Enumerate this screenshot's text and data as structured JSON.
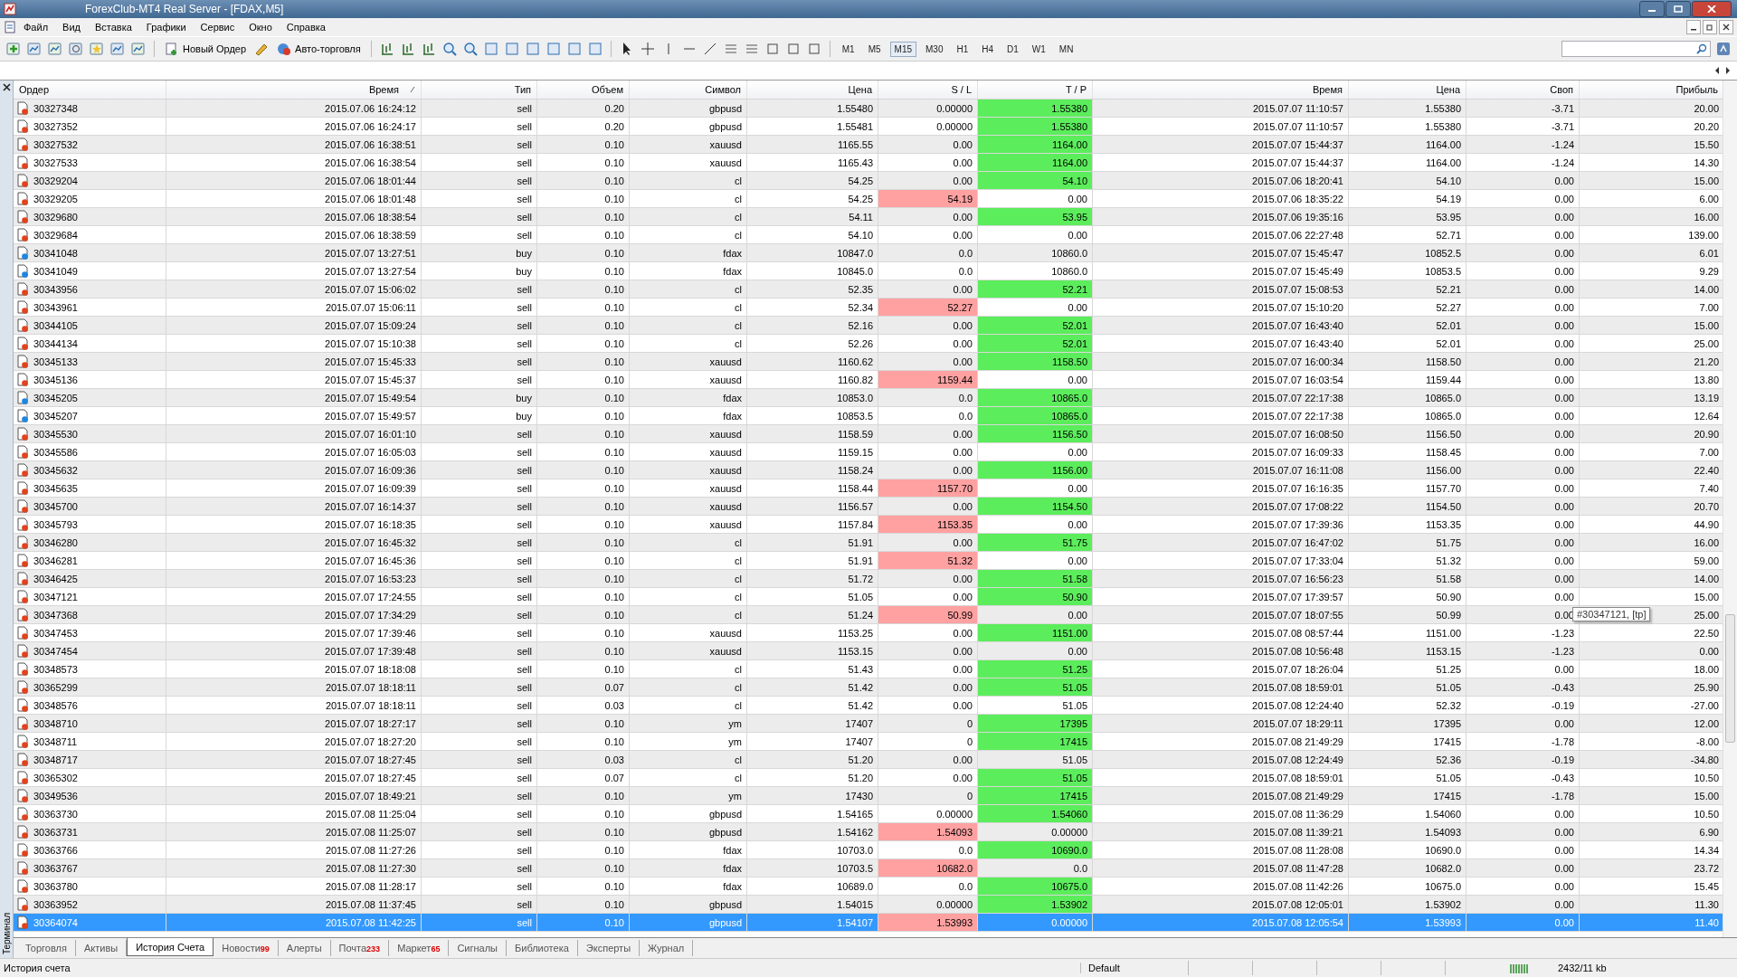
{
  "window": {
    "title": "ForexClub-MT4 Real Server - [FDAX,M5]"
  },
  "menu": [
    "Файл",
    "Вид",
    "Вставка",
    "Графики",
    "Сервис",
    "Окно",
    "Справка"
  ],
  "toolbar": {
    "new_order": "Новый Ордер",
    "auto_trading": "Авто-торговля",
    "timeframes": [
      {
        "label": "M1",
        "selected": false
      },
      {
        "label": "M5",
        "selected": false
      },
      {
        "label": "M15",
        "selected": true
      },
      {
        "label": "M30",
        "selected": false
      },
      {
        "label": "H1",
        "selected": false
      },
      {
        "label": "H4",
        "selected": false
      },
      {
        "label": "D1",
        "selected": false
      },
      {
        "label": "W1",
        "selected": false
      },
      {
        "label": "MN",
        "selected": false
      }
    ]
  },
  "terminal": {
    "side_label": "Терминал",
    "columns": [
      "Ордер",
      "Время",
      "Тип",
      "Объем",
      "Символ",
      "Цена",
      "S / L",
      "T / P",
      "Время",
      "Цена",
      "Своп",
      "Прибыль"
    ],
    "rows": [
      {
        "order": "30327348",
        "open_time": "2015.07.06 16:24:12",
        "type": "sell",
        "kind": "sell",
        "volume": "0.20",
        "symbol": "gbpusd",
        "open_price": "1.55480",
        "sl": "0.00000",
        "tp": "1.55380",
        "close_time": "2015.07.07 11:10:57",
        "close_price": "1.55380",
        "swap": "-3.71",
        "profit": "20.00",
        "sl_hit": false,
        "tp_hit": true,
        "selected": false
      },
      {
        "order": "30327352",
        "open_time": "2015.07.06 16:24:17",
        "type": "sell",
        "kind": "sell",
        "volume": "0.20",
        "symbol": "gbpusd",
        "open_price": "1.55481",
        "sl": "0.00000",
        "tp": "1.55380",
        "close_time": "2015.07.07 11:10:57",
        "close_price": "1.55380",
        "swap": "-3.71",
        "profit": "20.20",
        "sl_hit": false,
        "tp_hit": true,
        "selected": false
      },
      {
        "order": "30327532",
        "open_time": "2015.07.06 16:38:51",
        "type": "sell",
        "kind": "sell",
        "volume": "0.10",
        "symbol": "xauusd",
        "open_price": "1165.55",
        "sl": "0.00",
        "tp": "1164.00",
        "close_time": "2015.07.07 15:44:37",
        "close_price": "1164.00",
        "swap": "-1.24",
        "profit": "15.50",
        "sl_hit": false,
        "tp_hit": true,
        "selected": false
      },
      {
        "order": "30327533",
        "open_time": "2015.07.06 16:38:54",
        "type": "sell",
        "kind": "sell",
        "volume": "0.10",
        "symbol": "xauusd",
        "open_price": "1165.43",
        "sl": "0.00",
        "tp": "1164.00",
        "close_time": "2015.07.07 15:44:37",
        "close_price": "1164.00",
        "swap": "-1.24",
        "profit": "14.30",
        "sl_hit": false,
        "tp_hit": true,
        "selected": false
      },
      {
        "order": "30329204",
        "open_time": "2015.07.06 18:01:44",
        "type": "sell",
        "kind": "sell",
        "volume": "0.10",
        "symbol": "cl",
        "open_price": "54.25",
        "sl": "0.00",
        "tp": "54.10",
        "close_time": "2015.07.06 18:20:41",
        "close_price": "54.10",
        "swap": "0.00",
        "profit": "15.00",
        "sl_hit": false,
        "tp_hit": true,
        "selected": false
      },
      {
        "order": "30329205",
        "open_time": "2015.07.06 18:01:48",
        "type": "sell",
        "kind": "sell",
        "volume": "0.10",
        "symbol": "cl",
        "open_price": "54.25",
        "sl": "54.19",
        "tp": "0.00",
        "close_time": "2015.07.06 18:35:22",
        "close_price": "54.19",
        "swap": "0.00",
        "profit": "6.00",
        "sl_hit": true,
        "tp_hit": false,
        "selected": false
      },
      {
        "order": "30329680",
        "open_time": "2015.07.06 18:38:54",
        "type": "sell",
        "kind": "sell",
        "volume": "0.10",
        "symbol": "cl",
        "open_price": "54.11",
        "sl": "0.00",
        "tp": "53.95",
        "close_time": "2015.07.06 19:35:16",
        "close_price": "53.95",
        "swap": "0.00",
        "profit": "16.00",
        "sl_hit": false,
        "tp_hit": true,
        "selected": false
      },
      {
        "order": "30329684",
        "open_time": "2015.07.06 18:38:59",
        "type": "sell",
        "kind": "sell",
        "volume": "0.10",
        "symbol": "cl",
        "open_price": "54.10",
        "sl": "0.00",
        "tp": "0.00",
        "close_time": "2015.07.06 22:27:48",
        "close_price": "52.71",
        "swap": "0.00",
        "profit": "139.00",
        "sl_hit": false,
        "tp_hit": false,
        "selected": false
      },
      {
        "order": "30341048",
        "open_time": "2015.07.07 13:27:51",
        "type": "buy",
        "kind": "buy",
        "volume": "0.10",
        "symbol": "fdax",
        "open_price": "10847.0",
        "sl": "0.0",
        "tp": "10860.0",
        "close_time": "2015.07.07 15:45:47",
        "close_price": "10852.5",
        "swap": "0.00",
        "profit": "6.01",
        "sl_hit": false,
        "tp_hit": false,
        "selected": false
      },
      {
        "order": "30341049",
        "open_time": "2015.07.07 13:27:54",
        "type": "buy",
        "kind": "buy",
        "volume": "0.10",
        "symbol": "fdax",
        "open_price": "10845.0",
        "sl": "0.0",
        "tp": "10860.0",
        "close_time": "2015.07.07 15:45:49",
        "close_price": "10853.5",
        "swap": "0.00",
        "profit": "9.29",
        "sl_hit": false,
        "tp_hit": false,
        "selected": false
      },
      {
        "order": "30343956",
        "open_time": "2015.07.07 15:06:02",
        "type": "sell",
        "kind": "sell",
        "volume": "0.10",
        "symbol": "cl",
        "open_price": "52.35",
        "sl": "0.00",
        "tp": "52.21",
        "close_time": "2015.07.07 15:08:53",
        "close_price": "52.21",
        "swap": "0.00",
        "profit": "14.00",
        "sl_hit": false,
        "tp_hit": true,
        "selected": false
      },
      {
        "order": "30343961",
        "open_time": "2015.07.07 15:06:11",
        "type": "sell",
        "kind": "sell",
        "volume": "0.10",
        "symbol": "cl",
        "open_price": "52.34",
        "sl": "52.27",
        "tp": "0.00",
        "close_time": "2015.07.07 15:10:20",
        "close_price": "52.27",
        "swap": "0.00",
        "profit": "7.00",
        "sl_hit": true,
        "tp_hit": false,
        "selected": false
      },
      {
        "order": "30344105",
        "open_time": "2015.07.07 15:09:24",
        "type": "sell",
        "kind": "sell",
        "volume": "0.10",
        "symbol": "cl",
        "open_price": "52.16",
        "sl": "0.00",
        "tp": "52.01",
        "close_time": "2015.07.07 16:43:40",
        "close_price": "52.01",
        "swap": "0.00",
        "profit": "15.00",
        "sl_hit": false,
        "tp_hit": true,
        "selected": false
      },
      {
        "order": "30344134",
        "open_time": "2015.07.07 15:10:38",
        "type": "sell",
        "kind": "sell",
        "volume": "0.10",
        "symbol": "cl",
        "open_price": "52.26",
        "sl": "0.00",
        "tp": "52.01",
        "close_time": "2015.07.07 16:43:40",
        "close_price": "52.01",
        "swap": "0.00",
        "profit": "25.00",
        "sl_hit": false,
        "tp_hit": true,
        "selected": false
      },
      {
        "order": "30345133",
        "open_time": "2015.07.07 15:45:33",
        "type": "sell",
        "kind": "sell",
        "volume": "0.10",
        "symbol": "xauusd",
        "open_price": "1160.62",
        "sl": "0.00",
        "tp": "1158.50",
        "close_time": "2015.07.07 16:00:34",
        "close_price": "1158.50",
        "swap": "0.00",
        "profit": "21.20",
        "sl_hit": false,
        "tp_hit": true,
        "selected": false
      },
      {
        "order": "30345136",
        "open_time": "2015.07.07 15:45:37",
        "type": "sell",
        "kind": "sell",
        "volume": "0.10",
        "symbol": "xauusd",
        "open_price": "1160.82",
        "sl": "1159.44",
        "tp": "0.00",
        "close_time": "2015.07.07 16:03:54",
        "close_price": "1159.44",
        "swap": "0.00",
        "profit": "13.80",
        "sl_hit": true,
        "tp_hit": false,
        "selected": false
      },
      {
        "order": "30345205",
        "open_time": "2015.07.07 15:49:54",
        "type": "buy",
        "kind": "buy",
        "volume": "0.10",
        "symbol": "fdax",
        "open_price": "10853.0",
        "sl": "0.0",
        "tp": "10865.0",
        "close_time": "2015.07.07 22:17:38",
        "close_price": "10865.0",
        "swap": "0.00",
        "profit": "13.19",
        "sl_hit": false,
        "tp_hit": true,
        "selected": false
      },
      {
        "order": "30345207",
        "open_time": "2015.07.07 15:49:57",
        "type": "buy",
        "kind": "buy",
        "volume": "0.10",
        "symbol": "fdax",
        "open_price": "10853.5",
        "sl": "0.0",
        "tp": "10865.0",
        "close_time": "2015.07.07 22:17:38",
        "close_price": "10865.0",
        "swap": "0.00",
        "profit": "12.64",
        "sl_hit": false,
        "tp_hit": true,
        "selected": false
      },
      {
        "order": "30345530",
        "open_time": "2015.07.07 16:01:10",
        "type": "sell",
        "kind": "sell",
        "volume": "0.10",
        "symbol": "xauusd",
        "open_price": "1158.59",
        "sl": "0.00",
        "tp": "1156.50",
        "close_time": "2015.07.07 16:08:50",
        "close_price": "1156.50",
        "swap": "0.00",
        "profit": "20.90",
        "sl_hit": false,
        "tp_hit": true,
        "selected": false
      },
      {
        "order": "30345586",
        "open_time": "2015.07.07 16:05:03",
        "type": "sell",
        "kind": "sell",
        "volume": "0.10",
        "symbol": "xauusd",
        "open_price": "1159.15",
        "sl": "0.00",
        "tp": "0.00",
        "close_time": "2015.07.07 16:09:33",
        "close_price": "1158.45",
        "swap": "0.00",
        "profit": "7.00",
        "sl_hit": false,
        "tp_hit": false,
        "selected": false
      },
      {
        "order": "30345632",
        "open_time": "2015.07.07 16:09:36",
        "type": "sell",
        "kind": "sell",
        "volume": "0.10",
        "symbol": "xauusd",
        "open_price": "1158.24",
        "sl": "0.00",
        "tp": "1156.00",
        "close_time": "2015.07.07 16:11:08",
        "close_price": "1156.00",
        "swap": "0.00",
        "profit": "22.40",
        "sl_hit": false,
        "tp_hit": true,
        "selected": false
      },
      {
        "order": "30345635",
        "open_time": "2015.07.07 16:09:39",
        "type": "sell",
        "kind": "sell",
        "volume": "0.10",
        "symbol": "xauusd",
        "open_price": "1158.44",
        "sl": "1157.70",
        "tp": "0.00",
        "close_time": "2015.07.07 16:16:35",
        "close_price": "1157.70",
        "swap": "0.00",
        "profit": "7.40",
        "sl_hit": true,
        "tp_hit": false,
        "selected": false
      },
      {
        "order": "30345700",
        "open_time": "2015.07.07 16:14:37",
        "type": "sell",
        "kind": "sell",
        "volume": "0.10",
        "symbol": "xauusd",
        "open_price": "1156.57",
        "sl": "0.00",
        "tp": "1154.50",
        "close_time": "2015.07.07 17:08:22",
        "close_price": "1154.50",
        "swap": "0.00",
        "profit": "20.70",
        "sl_hit": false,
        "tp_hit": true,
        "selected": false
      },
      {
        "order": "30345793",
        "open_time": "2015.07.07 16:18:35",
        "type": "sell",
        "kind": "sell",
        "volume": "0.10",
        "symbol": "xauusd",
        "open_price": "1157.84",
        "sl": "1153.35",
        "tp": "0.00",
        "close_time": "2015.07.07 17:39:36",
        "close_price": "1153.35",
        "swap": "0.00",
        "profit": "44.90",
        "sl_hit": true,
        "tp_hit": false,
        "selected": false
      },
      {
        "order": "30346280",
        "open_time": "2015.07.07 16:45:32",
        "type": "sell",
        "kind": "sell",
        "volume": "0.10",
        "symbol": "cl",
        "open_price": "51.91",
        "sl": "0.00",
        "tp": "51.75",
        "close_time": "2015.07.07 16:47:02",
        "close_price": "51.75",
        "swap": "0.00",
        "profit": "16.00",
        "sl_hit": false,
        "tp_hit": true,
        "selected": false
      },
      {
        "order": "30346281",
        "open_time": "2015.07.07 16:45:36",
        "type": "sell",
        "kind": "sell",
        "volume": "0.10",
        "symbol": "cl",
        "open_price": "51.91",
        "sl": "51.32",
        "tp": "0.00",
        "close_time": "2015.07.07 17:33:04",
        "close_price": "51.32",
        "swap": "0.00",
        "profit": "59.00",
        "sl_hit": true,
        "tp_hit": false,
        "selected": false
      },
      {
        "order": "30346425",
        "open_time": "2015.07.07 16:53:23",
        "type": "sell",
        "kind": "sell",
        "volume": "0.10",
        "symbol": "cl",
        "open_price": "51.72",
        "sl": "0.00",
        "tp": "51.58",
        "close_time": "2015.07.07 16:56:23",
        "close_price": "51.58",
        "swap": "0.00",
        "profit": "14.00",
        "sl_hit": false,
        "tp_hit": true,
        "selected": false
      },
      {
        "order": "30347121",
        "open_time": "2015.07.07 17:24:55",
        "type": "sell",
        "kind": "sell",
        "volume": "0.10",
        "symbol": "cl",
        "open_price": "51.05",
        "sl": "0.00",
        "tp": "50.90",
        "close_time": "2015.07.07 17:39:57",
        "close_price": "50.90",
        "swap": "0.00",
        "profit": "15.00",
        "sl_hit": false,
        "tp_hit": true,
        "selected": false
      },
      {
        "order": "30347368",
        "open_time": "2015.07.07 17:34:29",
        "type": "sell",
        "kind": "sell",
        "volume": "0.10",
        "symbol": "cl",
        "open_price": "51.24",
        "sl": "50.99",
        "tp": "0.00",
        "close_time": "2015.07.07 18:07:55",
        "close_price": "50.99",
        "swap": "0.00",
        "profit": "25.00",
        "sl_hit": true,
        "tp_hit": false,
        "selected": false,
        "tooltip": "#30347121, [tp]"
      },
      {
        "order": "30347453",
        "open_time": "2015.07.07 17:39:46",
        "type": "sell",
        "kind": "sell",
        "volume": "0.10",
        "symbol": "xauusd",
        "open_price": "1153.25",
        "sl": "0.00",
        "tp": "1151.00",
        "close_time": "2015.07.08 08:57:44",
        "close_price": "1151.00",
        "swap": "-1.23",
        "profit": "22.50",
        "sl_hit": false,
        "tp_hit": true,
        "selected": false
      },
      {
        "order": "30347454",
        "open_time": "2015.07.07 17:39:48",
        "type": "sell",
        "kind": "sell",
        "volume": "0.10",
        "symbol": "xauusd",
        "open_price": "1153.15",
        "sl": "0.00",
        "tp": "0.00",
        "close_time": "2015.07.08 10:56:48",
        "close_price": "1153.15",
        "swap": "-1.23",
        "profit": "0.00",
        "sl_hit": false,
        "tp_hit": false,
        "selected": false
      },
      {
        "order": "30348573",
        "open_time": "2015.07.07 18:18:08",
        "type": "sell",
        "kind": "sell",
        "volume": "0.10",
        "symbol": "cl",
        "open_price": "51.43",
        "sl": "0.00",
        "tp": "51.25",
        "close_time": "2015.07.07 18:26:04",
        "close_price": "51.25",
        "swap": "0.00",
        "profit": "18.00",
        "sl_hit": false,
        "tp_hit": true,
        "selected": false
      },
      {
        "order": "30365299",
        "open_time": "2015.07.07 18:18:11",
        "type": "sell",
        "kind": "sell",
        "volume": "0.07",
        "symbol": "cl",
        "open_price": "51.42",
        "sl": "0.00",
        "tp": "51.05",
        "close_time": "2015.07.08 18:59:01",
        "close_price": "51.05",
        "swap": "-0.43",
        "profit": "25.90",
        "sl_hit": false,
        "tp_hit": true,
        "selected": false
      },
      {
        "order": "30348576",
        "open_time": "2015.07.07 18:18:11",
        "type": "sell",
        "kind": "sell",
        "volume": "0.03",
        "symbol": "cl",
        "open_price": "51.42",
        "sl": "0.00",
        "tp": "51.05",
        "close_time": "2015.07.08 12:24:40",
        "close_price": "52.32",
        "swap": "-0.19",
        "profit": "-27.00",
        "sl_hit": false,
        "tp_hit": false,
        "selected": false
      },
      {
        "order": "30348710",
        "open_time": "2015.07.07 18:27:17",
        "type": "sell",
        "kind": "sell",
        "volume": "0.10",
        "symbol": "ym",
        "open_price": "17407",
        "sl": "0",
        "tp": "17395",
        "close_time": "2015.07.07 18:29:11",
        "close_price": "17395",
        "swap": "0.00",
        "profit": "12.00",
        "sl_hit": false,
        "tp_hit": true,
        "selected": false
      },
      {
        "order": "30348711",
        "open_time": "2015.07.07 18:27:20",
        "type": "sell",
        "kind": "sell",
        "volume": "0.10",
        "symbol": "ym",
        "open_price": "17407",
        "sl": "0",
        "tp": "17415",
        "close_time": "2015.07.08 21:49:29",
        "close_price": "17415",
        "swap": "-1.78",
        "profit": "-8.00",
        "sl_hit": false,
        "tp_hit": true,
        "selected": false
      },
      {
        "order": "30348717",
        "open_time": "2015.07.07 18:27:45",
        "type": "sell",
        "kind": "sell",
        "volume": "0.03",
        "symbol": "cl",
        "open_price": "51.20",
        "sl": "0.00",
        "tp": "51.05",
        "close_time": "2015.07.08 12:24:49",
        "close_price": "52.36",
        "swap": "-0.19",
        "profit": "-34.80",
        "sl_hit": false,
        "tp_hit": false,
        "selected": false
      },
      {
        "order": "30365302",
        "open_time": "2015.07.07 18:27:45",
        "type": "sell",
        "kind": "sell",
        "volume": "0.07",
        "symbol": "cl",
        "open_price": "51.20",
        "sl": "0.00",
        "tp": "51.05",
        "close_time": "2015.07.08 18:59:01",
        "close_price": "51.05",
        "swap": "-0.43",
        "profit": "10.50",
        "sl_hit": false,
        "tp_hit": true,
        "selected": false
      },
      {
        "order": "30349536",
        "open_time": "2015.07.07 18:49:21",
        "type": "sell",
        "kind": "sell",
        "volume": "0.10",
        "symbol": "ym",
        "open_price": "17430",
        "sl": "0",
        "tp": "17415",
        "close_time": "2015.07.08 21:49:29",
        "close_price": "17415",
        "swap": "-1.78",
        "profit": "15.00",
        "sl_hit": false,
        "tp_hit": true,
        "selected": false
      },
      {
        "order": "30363730",
        "open_time": "2015.07.08 11:25:04",
        "type": "sell",
        "kind": "sell",
        "volume": "0.10",
        "symbol": "gbpusd",
        "open_price": "1.54165",
        "sl": "0.00000",
        "tp": "1.54060",
        "close_time": "2015.07.08 11:36:29",
        "close_price": "1.54060",
        "swap": "0.00",
        "profit": "10.50",
        "sl_hit": false,
        "tp_hit": true,
        "selected": false
      },
      {
        "order": "30363731",
        "open_time": "2015.07.08 11:25:07",
        "type": "sell",
        "kind": "sell",
        "volume": "0.10",
        "symbol": "gbpusd",
        "open_price": "1.54162",
        "sl": "1.54093",
        "tp": "0.00000",
        "close_time": "2015.07.08 11:39:21",
        "close_price": "1.54093",
        "swap": "0.00",
        "profit": "6.90",
        "sl_hit": true,
        "tp_hit": false,
        "selected": false
      },
      {
        "order": "30363766",
        "open_time": "2015.07.08 11:27:26",
        "type": "sell",
        "kind": "sell",
        "volume": "0.10",
        "symbol": "fdax",
        "open_price": "10703.0",
        "sl": "0.0",
        "tp": "10690.0",
        "close_time": "2015.07.08 11:28:08",
        "close_price": "10690.0",
        "swap": "0.00",
        "profit": "14.34",
        "sl_hit": false,
        "tp_hit": true,
        "selected": false
      },
      {
        "order": "30363767",
        "open_time": "2015.07.08 11:27:30",
        "type": "sell",
        "kind": "sell",
        "volume": "0.10",
        "symbol": "fdax",
        "open_price": "10703.5",
        "sl": "10682.0",
        "tp": "0.0",
        "close_time": "2015.07.08 11:47:28",
        "close_price": "10682.0",
        "swap": "0.00",
        "profit": "23.72",
        "sl_hit": true,
        "tp_hit": false,
        "selected": false
      },
      {
        "order": "30363780",
        "open_time": "2015.07.08 11:28:17",
        "type": "sell",
        "kind": "sell",
        "volume": "0.10",
        "symbol": "fdax",
        "open_price": "10689.0",
        "sl": "0.0",
        "tp": "10675.0",
        "close_time": "2015.07.08 11:42:26",
        "close_price": "10675.0",
        "swap": "0.00",
        "profit": "15.45",
        "sl_hit": false,
        "tp_hit": true,
        "selected": false
      },
      {
        "order": "30363952",
        "open_time": "2015.07.08 11:37:45",
        "type": "sell",
        "kind": "sell",
        "volume": "0.10",
        "symbol": "gbpusd",
        "open_price": "1.54015",
        "sl": "0.00000",
        "tp": "1.53902",
        "close_time": "2015.07.08 12:05:01",
        "close_price": "1.53902",
        "swap": "0.00",
        "profit": "11.30",
        "sl_hit": false,
        "tp_hit": true,
        "selected": false
      },
      {
        "order": "30364074",
        "open_time": "2015.07.08 11:42:25",
        "type": "sell",
        "kind": "sell",
        "volume": "0.10",
        "symbol": "gbpusd",
        "open_price": "1.54107",
        "sl": "1.53993",
        "tp": "0.00000",
        "close_time": "2015.07.08 12:05:54",
        "close_price": "1.53993",
        "swap": "0.00",
        "profit": "11.40",
        "sl_hit": true,
        "tp_hit": false,
        "selected": true
      }
    ],
    "tabs": [
      {
        "label": "Торговля",
        "selected": false
      },
      {
        "label": "Активы",
        "selected": false
      },
      {
        "label": "История Счета",
        "selected": true
      },
      {
        "label": "Новости",
        "badge": "99",
        "selected": false
      },
      {
        "label": "Алерты",
        "selected": false
      },
      {
        "label": "Почта",
        "badge": "233",
        "selected": false
      },
      {
        "label": "Маркет",
        "badge": "65",
        "selected": false
      },
      {
        "label": "Сигналы",
        "selected": false
      },
      {
        "label": "Библиотека",
        "selected": false
      },
      {
        "label": "Эксперты",
        "selected": false
      },
      {
        "label": "Журнал",
        "selected": false
      }
    ]
  },
  "status_bar": {
    "hint": "История счета",
    "profile": "Default",
    "traffic": "2432/11 kb"
  }
}
